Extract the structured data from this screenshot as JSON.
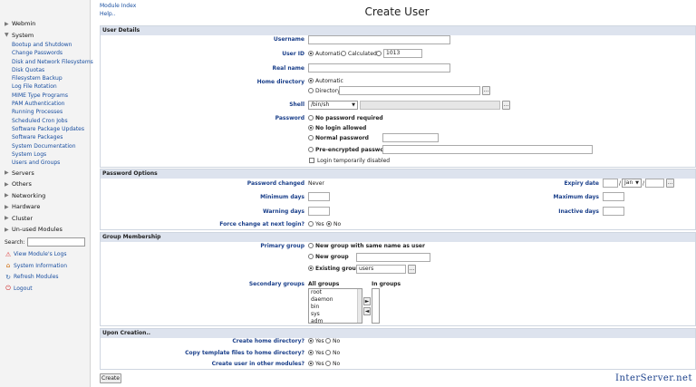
{
  "sidebar": {
    "categories_top": [
      {
        "label": "Webmin",
        "expanded": false
      },
      {
        "label": "System",
        "expanded": true
      }
    ],
    "system_items": [
      "Bootup and Shutdown",
      "Change Passwords",
      "Disk and Network Filesystems",
      "Disk Quotas",
      "Filesystem Backup",
      "Log File Rotation",
      "MIME Type Programs",
      "PAM Authentication",
      "Running Processes",
      "Scheduled Cron Jobs",
      "Software Package Updates",
      "Software Packages",
      "System Documentation",
      "System Logs",
      "Users and Groups"
    ],
    "categories_bottom": [
      "Servers",
      "Others",
      "Networking",
      "Hardware",
      "Cluster",
      "Un-used Modules"
    ],
    "search_label": "Search:",
    "links": [
      {
        "label": "View Module's Logs",
        "icon": "warning-icon"
      },
      {
        "label": "System Information",
        "icon": "home-icon"
      },
      {
        "label": "Refresh Modules",
        "icon": "refresh-icon"
      },
      {
        "label": "Logout",
        "icon": "logout-icon"
      }
    ]
  },
  "header": {
    "module_index": "Module Index",
    "help": "Help..",
    "title": "Create User"
  },
  "user_details": {
    "heading": "User Details",
    "username_label": "Username",
    "userid_label": "User ID",
    "userid_automatic": "Automatic",
    "userid_calculated": "Calculated",
    "userid_value": "1013",
    "realname_label": "Real name",
    "homedir_label": "Home directory",
    "homedir_automatic": "Automatic",
    "homedir_directory": "Directory",
    "shell_label": "Shell",
    "shell_value": "/bin/sh",
    "password_label": "Password",
    "pw_none": "No password required",
    "pw_nologin": "No login allowed",
    "pw_normal": "Normal password",
    "pw_preenc": "Pre-encrypted password",
    "login_disabled": "Login temporarily disabled",
    "browse": "..."
  },
  "password_options": {
    "heading": "Password Options",
    "changed_label": "Password changed",
    "changed_value": "Never",
    "expiry_label": "Expiry date",
    "expiry_month": "Jan",
    "min_label": "Minimum days",
    "max_label": "Maximum days",
    "warning_label": "Warning days",
    "inactive_label": "Inactive days",
    "force_label": "Force change at next login?",
    "yes": "Yes",
    "no": "No"
  },
  "group_membership": {
    "heading": "Group Membership",
    "primary_label": "Primary group",
    "opt_same": "New group with same name as user",
    "opt_new": "New group",
    "opt_existing": "Existing group",
    "existing_value": "users",
    "secondary_label": "Secondary groups",
    "all_groups_label": "All groups",
    "in_groups_label": "In groups",
    "all_groups": [
      "root",
      "daemon",
      "bin",
      "sys",
      "adm"
    ],
    "move_right": "►",
    "move_left": "◄"
  },
  "upon_creation": {
    "heading": "Upon Creation..",
    "create_home_label": "Create home directory?",
    "copy_files_label": "Copy template files to home directory?",
    "other_modules_label": "Create user in other modules?",
    "yes": "Yes",
    "no": "No"
  },
  "create_button": "Create",
  "logo": "InterServer.net"
}
